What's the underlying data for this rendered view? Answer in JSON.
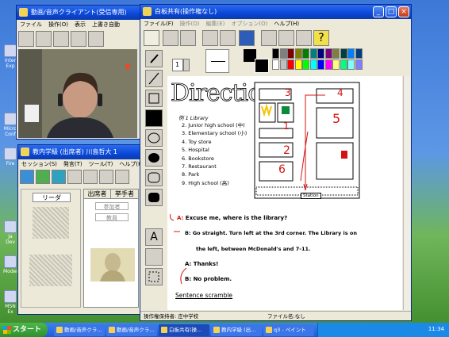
{
  "desktop": {
    "icons": [
      {
        "label": "Inter Exp"
      },
      {
        "label": "Micro Conf"
      },
      {
        "label": "Fire"
      },
      {
        "label": "Ja Dev"
      },
      {
        "label": "Modem"
      },
      {
        "label": "MSN Ex"
      }
    ]
  },
  "video_window": {
    "title": "動画/音声クライアント(受信専用)",
    "menu": [
      "ファイル",
      "操作(O)",
      "表示",
      "上書き自動"
    ]
  },
  "classroom_window": {
    "title": "教内学級 (出席者) 川島哲大 1",
    "menu": [
      "セッション(S)",
      "発言(T)",
      "ツール(T)",
      "ヘルプ(H)"
    ],
    "leader_label": "リーダ",
    "tabs": [
      "出席者",
      "挙手者"
    ],
    "list_items": [
      "参加者",
      "教員"
    ]
  },
  "whiteboard": {
    "title": "白板共有(操作権なし)",
    "menu": [
      "ファイル(F)",
      "操作(O)",
      "編集(E)",
      "オプション(O)",
      "ヘルプ(H)"
    ],
    "line_width": "1",
    "heading": "Directions",
    "example_label": "例 1 Library",
    "places": [
      "2.  Junior high school (中)",
      "3.  Elementary school (小)",
      "4.  Toy store",
      "5.  Hospital",
      "6.  Bookstore",
      "7.  Restaurant",
      "8.  Park",
      "9.  High school (高)"
    ],
    "station_label": "Station",
    "map_numbers": [
      "3",
      "4",
      "1",
      "5",
      "2",
      "6"
    ],
    "dialog": {
      "a_label": "A:",
      "a_text": "Excuse me, where is the library?",
      "b_label": "B:",
      "b_line1": "Go straight. Turn left at the 3rd corner. The Library is on",
      "b_line2": "the left, between McDonald's and 7-11.",
      "a2_label": "A:",
      "a2_text": "Thanks!",
      "b2_label": "B:",
      "b2_text": "No problem."
    },
    "scramble": "Sentence scramble",
    "status_left": "操作権保持者: 庄中学校",
    "status_right": "ファイル名:なし",
    "palette": [
      "#000000",
      "#7f7f7f",
      "#7f0000",
      "#7f7f00",
      "#007f00",
      "#007f7f",
      "#00007f",
      "#7f007f",
      "#7f7f3f",
      "#003f3f",
      "#007fff",
      "#003f7f",
      "#ffffff",
      "#bfbfbf",
      "#ff0000",
      "#ffff00",
      "#00ff00",
      "#00ffff",
      "#0000ff",
      "#ff00ff",
      "#ffff7f",
      "#00ff7f",
      "#7fffff",
      "#7f7fff"
    ]
  },
  "taskbar": {
    "start": "スタート",
    "tasks": [
      "動画/音声クラ...",
      "動画/音声クラ...",
      "白板共有(操...",
      "教内学級 (出...",
      "q3 - ペイント"
    ],
    "clock": "11:34"
  }
}
